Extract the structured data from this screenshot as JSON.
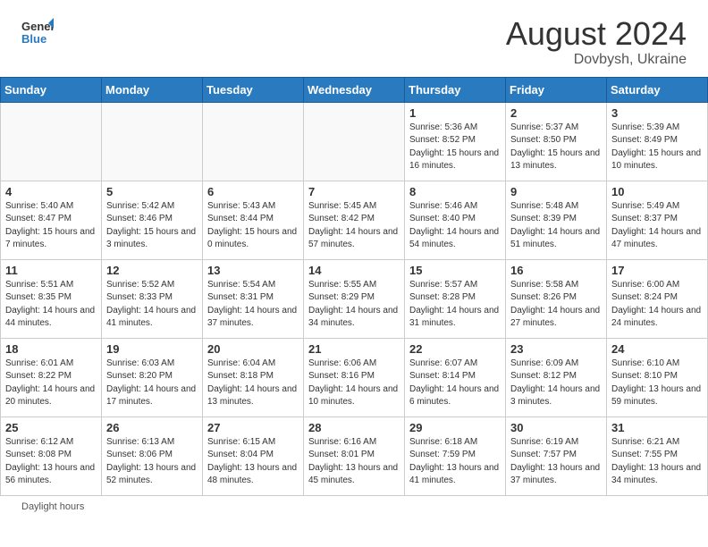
{
  "header": {
    "logo_general": "General",
    "logo_blue": "Blue",
    "month_year": "August 2024",
    "location": "Dovbysh, Ukraine"
  },
  "days_of_week": [
    "Sunday",
    "Monday",
    "Tuesday",
    "Wednesday",
    "Thursday",
    "Friday",
    "Saturday"
  ],
  "weeks": [
    [
      {
        "day": "",
        "info": ""
      },
      {
        "day": "",
        "info": ""
      },
      {
        "day": "",
        "info": ""
      },
      {
        "day": "",
        "info": ""
      },
      {
        "day": "1",
        "info": "Sunrise: 5:36 AM\nSunset: 8:52 PM\nDaylight: 15 hours and 16 minutes."
      },
      {
        "day": "2",
        "info": "Sunrise: 5:37 AM\nSunset: 8:50 PM\nDaylight: 15 hours and 13 minutes."
      },
      {
        "day": "3",
        "info": "Sunrise: 5:39 AM\nSunset: 8:49 PM\nDaylight: 15 hours and 10 minutes."
      }
    ],
    [
      {
        "day": "4",
        "info": "Sunrise: 5:40 AM\nSunset: 8:47 PM\nDaylight: 15 hours and 7 minutes."
      },
      {
        "day": "5",
        "info": "Sunrise: 5:42 AM\nSunset: 8:46 PM\nDaylight: 15 hours and 3 minutes."
      },
      {
        "day": "6",
        "info": "Sunrise: 5:43 AM\nSunset: 8:44 PM\nDaylight: 15 hours and 0 minutes."
      },
      {
        "day": "7",
        "info": "Sunrise: 5:45 AM\nSunset: 8:42 PM\nDaylight: 14 hours and 57 minutes."
      },
      {
        "day": "8",
        "info": "Sunrise: 5:46 AM\nSunset: 8:40 PM\nDaylight: 14 hours and 54 minutes."
      },
      {
        "day": "9",
        "info": "Sunrise: 5:48 AM\nSunset: 8:39 PM\nDaylight: 14 hours and 51 minutes."
      },
      {
        "day": "10",
        "info": "Sunrise: 5:49 AM\nSunset: 8:37 PM\nDaylight: 14 hours and 47 minutes."
      }
    ],
    [
      {
        "day": "11",
        "info": "Sunrise: 5:51 AM\nSunset: 8:35 PM\nDaylight: 14 hours and 44 minutes."
      },
      {
        "day": "12",
        "info": "Sunrise: 5:52 AM\nSunset: 8:33 PM\nDaylight: 14 hours and 41 minutes."
      },
      {
        "day": "13",
        "info": "Sunrise: 5:54 AM\nSunset: 8:31 PM\nDaylight: 14 hours and 37 minutes."
      },
      {
        "day": "14",
        "info": "Sunrise: 5:55 AM\nSunset: 8:29 PM\nDaylight: 14 hours and 34 minutes."
      },
      {
        "day": "15",
        "info": "Sunrise: 5:57 AM\nSunset: 8:28 PM\nDaylight: 14 hours and 31 minutes."
      },
      {
        "day": "16",
        "info": "Sunrise: 5:58 AM\nSunset: 8:26 PM\nDaylight: 14 hours and 27 minutes."
      },
      {
        "day": "17",
        "info": "Sunrise: 6:00 AM\nSunset: 8:24 PM\nDaylight: 14 hours and 24 minutes."
      }
    ],
    [
      {
        "day": "18",
        "info": "Sunrise: 6:01 AM\nSunset: 8:22 PM\nDaylight: 14 hours and 20 minutes."
      },
      {
        "day": "19",
        "info": "Sunrise: 6:03 AM\nSunset: 8:20 PM\nDaylight: 14 hours and 17 minutes."
      },
      {
        "day": "20",
        "info": "Sunrise: 6:04 AM\nSunset: 8:18 PM\nDaylight: 14 hours and 13 minutes."
      },
      {
        "day": "21",
        "info": "Sunrise: 6:06 AM\nSunset: 8:16 PM\nDaylight: 14 hours and 10 minutes."
      },
      {
        "day": "22",
        "info": "Sunrise: 6:07 AM\nSunset: 8:14 PM\nDaylight: 14 hours and 6 minutes."
      },
      {
        "day": "23",
        "info": "Sunrise: 6:09 AM\nSunset: 8:12 PM\nDaylight: 14 hours and 3 minutes."
      },
      {
        "day": "24",
        "info": "Sunrise: 6:10 AM\nSunset: 8:10 PM\nDaylight: 13 hours and 59 minutes."
      }
    ],
    [
      {
        "day": "25",
        "info": "Sunrise: 6:12 AM\nSunset: 8:08 PM\nDaylight: 13 hours and 56 minutes."
      },
      {
        "day": "26",
        "info": "Sunrise: 6:13 AM\nSunset: 8:06 PM\nDaylight: 13 hours and 52 minutes."
      },
      {
        "day": "27",
        "info": "Sunrise: 6:15 AM\nSunset: 8:04 PM\nDaylight: 13 hours and 48 minutes."
      },
      {
        "day": "28",
        "info": "Sunrise: 6:16 AM\nSunset: 8:01 PM\nDaylight: 13 hours and 45 minutes."
      },
      {
        "day": "29",
        "info": "Sunrise: 6:18 AM\nSunset: 7:59 PM\nDaylight: 13 hours and 41 minutes."
      },
      {
        "day": "30",
        "info": "Sunrise: 6:19 AM\nSunset: 7:57 PM\nDaylight: 13 hours and 37 minutes."
      },
      {
        "day": "31",
        "info": "Sunrise: 6:21 AM\nSunset: 7:55 PM\nDaylight: 13 hours and 34 minutes."
      }
    ]
  ],
  "footer": {
    "note": "Daylight hours"
  }
}
